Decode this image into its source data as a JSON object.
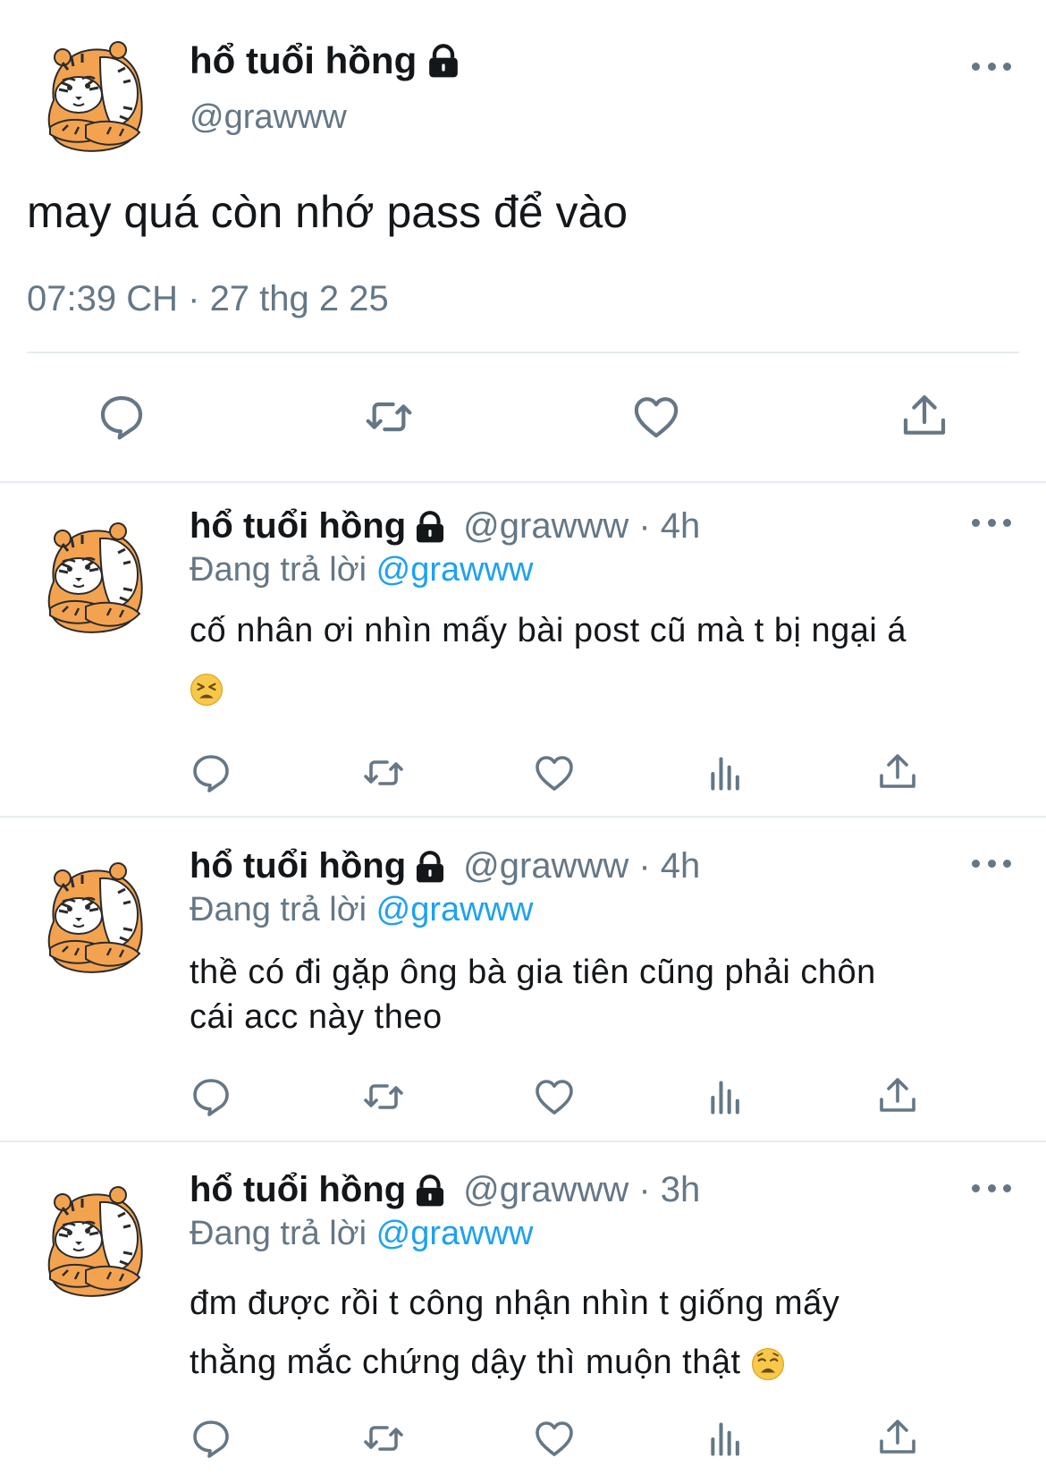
{
  "main": {
    "display_name": "hổ tuổi hồng",
    "handle": "@grawww",
    "text": "may quá còn nhớ pass để vào",
    "time": "07:39 CH",
    "date_sep": "·",
    "date": "27 thg 2 25"
  },
  "replies": [
    {
      "display_name": "hổ tuổi hồng",
      "handle_time": "@grawww · 4h",
      "replying_label": "Đang trả lời",
      "replying_to": "@grawww",
      "line1": "cố nhân ơi nhìn mấy bài post cũ mà t bị ngại á",
      "line2": "",
      "emoji": "tired-face"
    },
    {
      "display_name": "hổ tuổi hồng",
      "handle_time": "@grawww · 4h",
      "replying_label": "Đang trả lời",
      "replying_to": "@grawww",
      "line1": "thề có đi gặp ông bà gia tiên cũng phải chôn",
      "line2": "cái acc này theo"
    },
    {
      "display_name": "hổ tuổi hồng",
      "handle_time": "@grawww · 3h",
      "replying_label": "Đang trả lời",
      "replying_to": "@grawww",
      "line1": "đm được rồi t công nhận nhìn t giống mấy",
      "line2": "thằng mắc chứng dậy thì muộn thật",
      "emoji": "weary-face"
    }
  ],
  "colors": {
    "accent": "#1da1f2",
    "secondary": "#657786",
    "divider": "#e6ecf0"
  }
}
